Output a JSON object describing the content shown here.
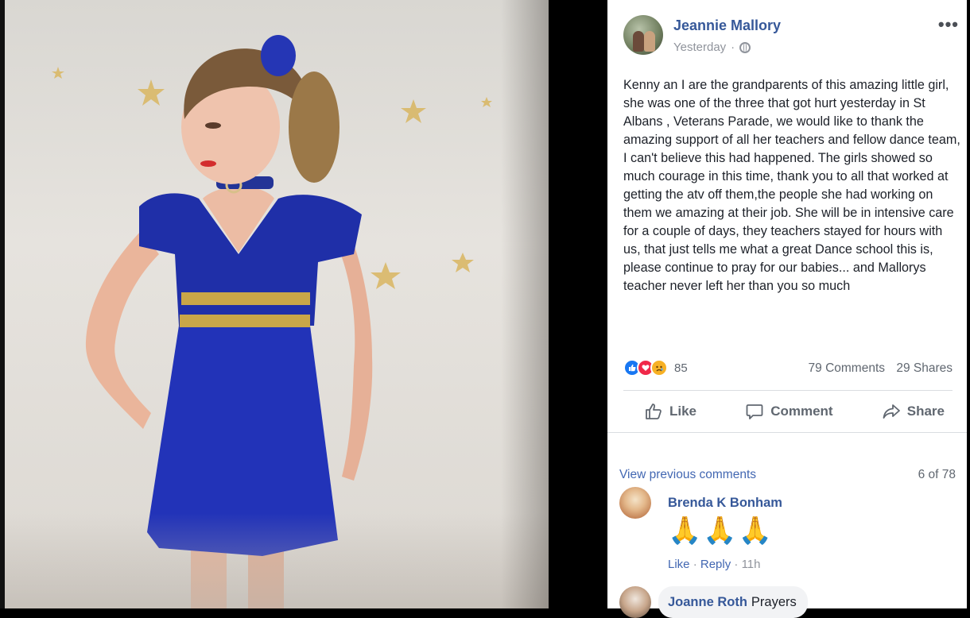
{
  "post": {
    "author": "Jeannie Mallory",
    "timestamp": "Yesterday",
    "more_label": "•••",
    "text": "Kenny an I are the grandparents of this amazing little girl, she was one of the three that got hurt yesterday in St Albans , Veterans Parade, we would like to thank the amazing support of all her teachers and fellow dance team, I can't believe this had happened. The girls showed so much courage in this time, thank you to all that worked at getting the atv off them,the people she had working on them we amazing at their job. She will be in intensive care for a couple of days, they teachers stayed for hours with us, that just tells me what a great Dance school this is, please continue to pray for our babies... and Mallorys teacher never left her than you so much",
    "reaction_count": "85",
    "comments_count": "79 Comments",
    "shares_count": "29 Shares"
  },
  "actions": {
    "like": "Like",
    "comment": "Comment",
    "share": "Share"
  },
  "comments": {
    "view_previous": "View previous comments",
    "position": "6 of 78",
    "items": [
      {
        "name": "Brenda K Bonham",
        "text": "🙏🙏🙏",
        "like": "Like",
        "reply": "Reply",
        "time": "11h"
      },
      {
        "name": "Joanne Roth",
        "text": "Prayers"
      }
    ]
  },
  "colors": {
    "link": "#365899",
    "meta": "#90949c",
    "like_reaction": "#1877f2",
    "love_reaction": "#f02849",
    "sad_reaction": "#f7b125"
  }
}
